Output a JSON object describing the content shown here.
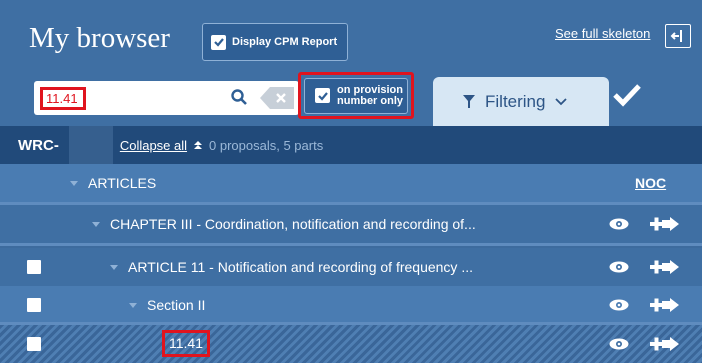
{
  "header": {
    "title": "My browser",
    "cpm_button_label": "Display CPM Report",
    "see_full_link": "See full skeleton"
  },
  "search": {
    "value": "11.41",
    "provision_toggle_line1": "on provision",
    "provision_toggle_line2": "number only",
    "filter_tab_label": "Filtering"
  },
  "wrc_bar": {
    "label": "WRC-",
    "collapse_all": "Collapse all",
    "counts": "0 proposals, 5 parts"
  },
  "tree": {
    "articles_label": "ARTICLES",
    "noc_label": "NOC",
    "chapter_label": "CHAPTER III - Coordination, notification and recording of...",
    "article_label": "ARTICLE 11 - Notification and recording of frequency ...",
    "section_label": "Section II",
    "item_label": "11.41"
  },
  "colors": {
    "highlight": "#e0141e",
    "header_bg": "#3f6fa3",
    "bar_bg": "#214a7a"
  }
}
